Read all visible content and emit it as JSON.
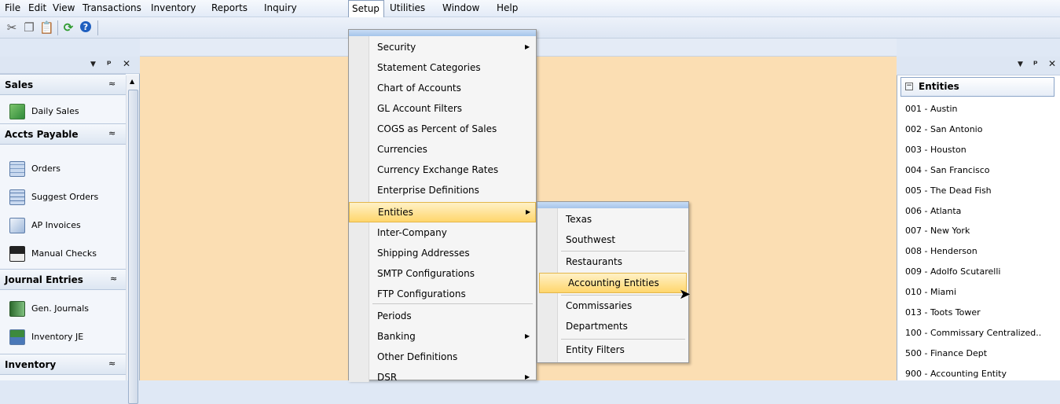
{
  "menubar": {
    "items": [
      "File",
      "Edit",
      "View",
      "Transactions",
      "Inventory",
      "Reports",
      "Inquiry",
      "Setup",
      "Utilities",
      "Window",
      "Help"
    ]
  },
  "toolbar": {
    "icons": [
      "scissors-icon",
      "copy-icon",
      "paste-icon",
      "refresh-icon",
      "help-icon"
    ]
  },
  "left_panel": {
    "groups": [
      {
        "title": "Sales",
        "items": [
          {
            "label": "Daily Sales",
            "icon": "daily-sales-icon"
          }
        ]
      },
      {
        "title": "Accts Payable",
        "items": [
          {
            "label": "Orders",
            "icon": "orders-icon"
          },
          {
            "label": "Suggest Orders",
            "icon": "suggest-orders-icon"
          },
          {
            "label": "AP Invoices",
            "icon": "ap-invoices-icon"
          },
          {
            "label": "Manual Checks",
            "icon": "manual-checks-icon"
          }
        ]
      },
      {
        "title": "Journal Entries",
        "items": [
          {
            "label": "Gen. Journals",
            "icon": "gen-journals-icon"
          },
          {
            "label": "Inventory JE",
            "icon": "inventory-je-icon"
          }
        ]
      },
      {
        "title": "Inventory",
        "items": []
      }
    ],
    "collapse_glyph": "»"
  },
  "setup_menu": {
    "items": [
      {
        "label": "Security",
        "submenu": true
      },
      {
        "label": "Statement Categories",
        "submenu": false
      },
      {
        "label": "Chart of Accounts",
        "submenu": false
      },
      {
        "label": "GL Account Filters",
        "submenu": false
      },
      {
        "label": "COGS as Percent of Sales",
        "submenu": false
      },
      {
        "label": "Currencies",
        "submenu": false
      },
      {
        "label": "Currency Exchange Rates",
        "submenu": false
      },
      {
        "label": "Enterprise Definitions",
        "submenu": false
      },
      {
        "label": "Entities",
        "submenu": true,
        "highlighted": true
      },
      {
        "label": "Inter-Company",
        "submenu": false
      },
      {
        "label": "Shipping Addresses",
        "submenu": false
      },
      {
        "label": "SMTP Configurations",
        "submenu": false
      },
      {
        "label": "FTP Configurations",
        "submenu": false
      },
      {
        "label": "Periods",
        "submenu": false
      },
      {
        "label": "Banking",
        "submenu": true
      },
      {
        "label": "Other Definitions",
        "submenu": false
      },
      {
        "label": "DSR",
        "submenu": true
      }
    ]
  },
  "entities_submenu": {
    "items": [
      {
        "label": "Texas"
      },
      {
        "label": "Southwest"
      },
      {
        "label": "Restaurants"
      },
      {
        "label": "Accounting Entities",
        "highlighted": true
      },
      {
        "label": "Commissaries"
      },
      {
        "label": "Departments"
      },
      {
        "label": "Entity Filters"
      }
    ]
  },
  "right_panel": {
    "title": "Entities",
    "entities": [
      "001 - Austin",
      "002 - San Antonio",
      "003 - Houston",
      "004 - San Francisco",
      "005 - The Dead Fish",
      "006 - Atlanta",
      "007 - New York",
      "008 - Henderson",
      "009 - Adolfo Scutarelli",
      "010 - Miami",
      "013 - Toots Tower",
      "100 - Commissary Centralized..",
      "500 - Finance Dept",
      "900 - Accounting Entity"
    ]
  },
  "colors": {
    "workspace_bg": "#fbdeb3",
    "menu_highlight": "#ffd66c",
    "header_bg": "#dde6f3"
  }
}
